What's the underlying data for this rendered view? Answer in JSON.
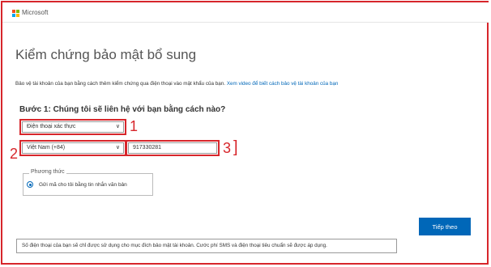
{
  "header": {
    "brand": "Microsoft"
  },
  "page": {
    "title": "Kiểm chứng bảo mật bổ sung",
    "description": "Bảo vệ tài khoản của bạn bằng cách thêm kiểm chứng qua điện thoại vào mật khẩu của bạn.",
    "video_link": "Xem video để biết cách bảo vệ tài khoản của bạn"
  },
  "step1": {
    "heading": "Bước 1: Chúng tôi sẽ liên hệ với bạn bằng cách nào?",
    "method_select": "Điện thoại xác thực",
    "country_select": "Việt Nam (+84)",
    "phone_value": "917330281"
  },
  "annotations": {
    "n1": "1",
    "n2": "2",
    "n3": "3",
    "bracket": "]"
  },
  "method_group": {
    "legend": "Phương thức",
    "option_sms": "Gửi mã cho tôi bằng tin nhắn văn bản"
  },
  "actions": {
    "next": "Tiếp theo"
  },
  "footer": {
    "note": "Số điện thoại của bạn sẽ chỉ được sử dụng cho mục đích bảo mật tài khoản. Cước phí SMS và điện thoại tiêu chuẩn sẽ được áp dụng."
  },
  "colors": {
    "accent": "#0067b8",
    "highlight": "#d7262b"
  }
}
